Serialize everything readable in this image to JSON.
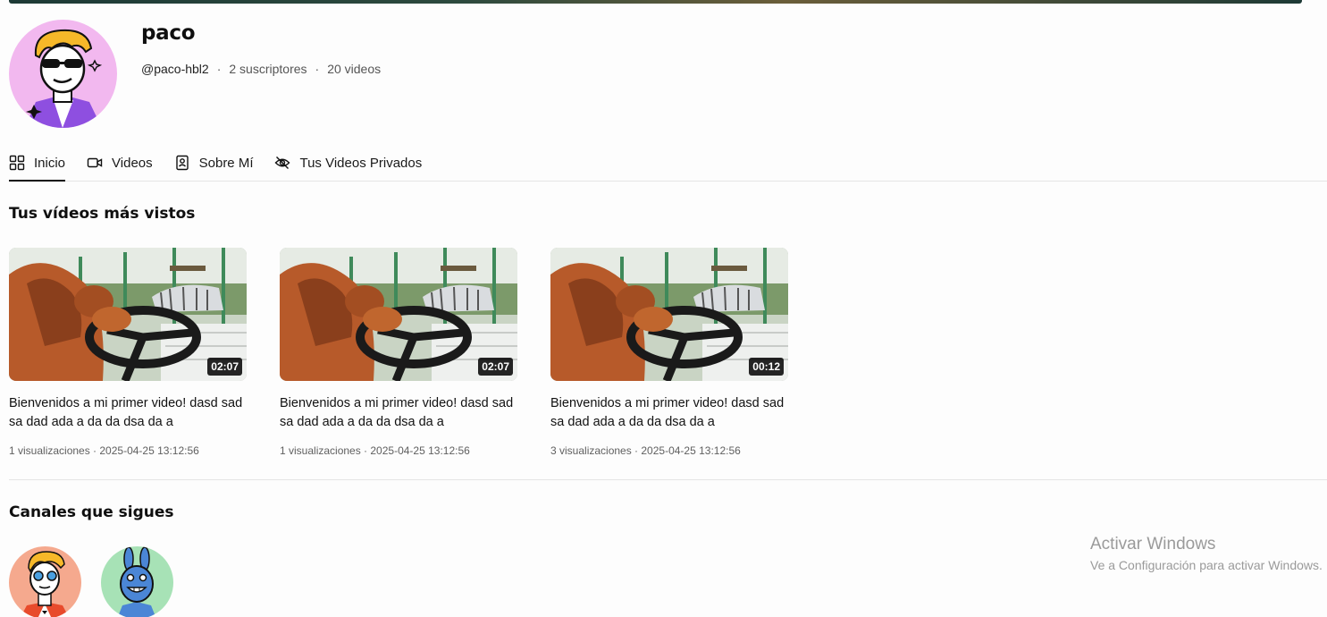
{
  "channel": {
    "name": "paco",
    "handle": "@paco-hbl2",
    "separator": "·",
    "subscribers": "2 suscriptores",
    "videos_count": "20 videos"
  },
  "tabs": [
    {
      "label": "Inicio",
      "icon": "grid-icon",
      "active": true
    },
    {
      "label": "Videos",
      "icon": "video-camera-icon",
      "active": false
    },
    {
      "label": "Sobre Mí",
      "icon": "contact-book-icon",
      "active": false
    },
    {
      "label": "Tus Videos Privados",
      "icon": "eye-off-icon",
      "active": false
    }
  ],
  "sections": {
    "most_viewed": "Tus vídeos más vistos",
    "following": "Canales que sigues"
  },
  "videos": [
    {
      "duration": "02:07",
      "title": "Bienvenidos a mi primer video! dasd sad sa dad ada a da da dsa da a",
      "meta": "1 visualizaciones · 2025-04-25 13:12:56"
    },
    {
      "duration": "02:07",
      "title": "Bienvenidos a mi primer video! dasd sad sa dad ada a da da dsa da a",
      "meta": "1 visualizaciones · 2025-04-25 13:12:56"
    },
    {
      "duration": "00:12",
      "title": "Bienvenidos a mi primer video! dasd sad sa dad ada a da da dsa da a",
      "meta": "3 visualizaciones · 2025-04-25 13:12:56"
    }
  ],
  "followed_channels": [
    {
      "avatar_bg": "#f5a98e"
    },
    {
      "avatar_bg": "#a7e2b6"
    }
  ],
  "watermark": {
    "title": "Activar Windows",
    "subtitle": "Ve a Configuración para activar Windows."
  },
  "colors": {
    "avatar_main_bg": "#f2b8ef",
    "accent": "#0f0f0f"
  }
}
